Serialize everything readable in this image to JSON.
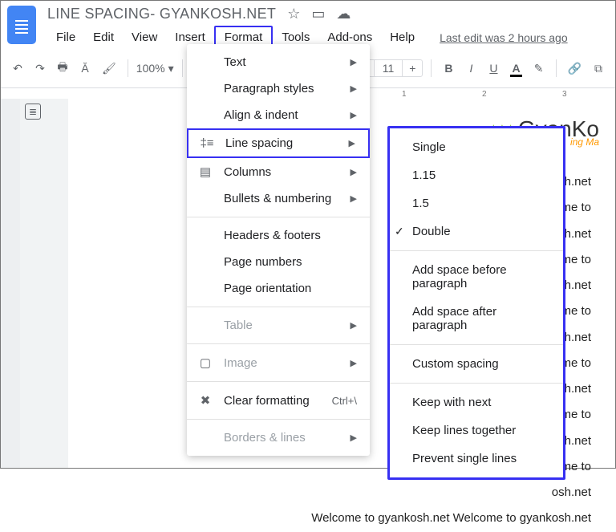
{
  "doc": {
    "title": "LINE SPACING- GYANKOSH.NET",
    "last_edit": "Last edit was 2 hours ago"
  },
  "menus": {
    "file": "File",
    "edit": "Edit",
    "view": "View",
    "insert": "Insert",
    "format": "Format",
    "tools": "Tools",
    "addons": "Add-ons",
    "help": "Help"
  },
  "toolbar": {
    "zoom": "100%",
    "font_size": "11"
  },
  "brand": {
    "name": "GyanKo",
    "sub": "ing Ma"
  },
  "body_text": "osh.net\nome to\nosh.net\nome to\nosh.net\nome to\nosh.net\nome to\nosh.net\nome to\nosh.net\nome to\nosh.net\nWelcome to gyankosh.net Welcome to gyankosh.net",
  "format_menu": {
    "text": "Text",
    "paragraph": "Paragraph styles",
    "align": "Align & indent",
    "line_spacing": "Line spacing",
    "columns": "Columns",
    "bullets": "Bullets & numbering",
    "headers": "Headers & footers",
    "page_numbers": "Page numbers",
    "page_orientation": "Page orientation",
    "table": "Table",
    "image": "Image",
    "clear": "Clear formatting",
    "clear_key": "Ctrl+\\",
    "borders": "Borders & lines"
  },
  "spacing_menu": {
    "single": "Single",
    "v115": "1.15",
    "v15": "1.5",
    "double": "Double",
    "before": "Add space before paragraph",
    "after": "Add space after paragraph",
    "custom": "Custom spacing",
    "keep_next": "Keep with next",
    "keep_together": "Keep lines together",
    "prevent": "Prevent single lines"
  },
  "ruler": {
    "r1": "1",
    "r2": "2",
    "r3": "3"
  }
}
